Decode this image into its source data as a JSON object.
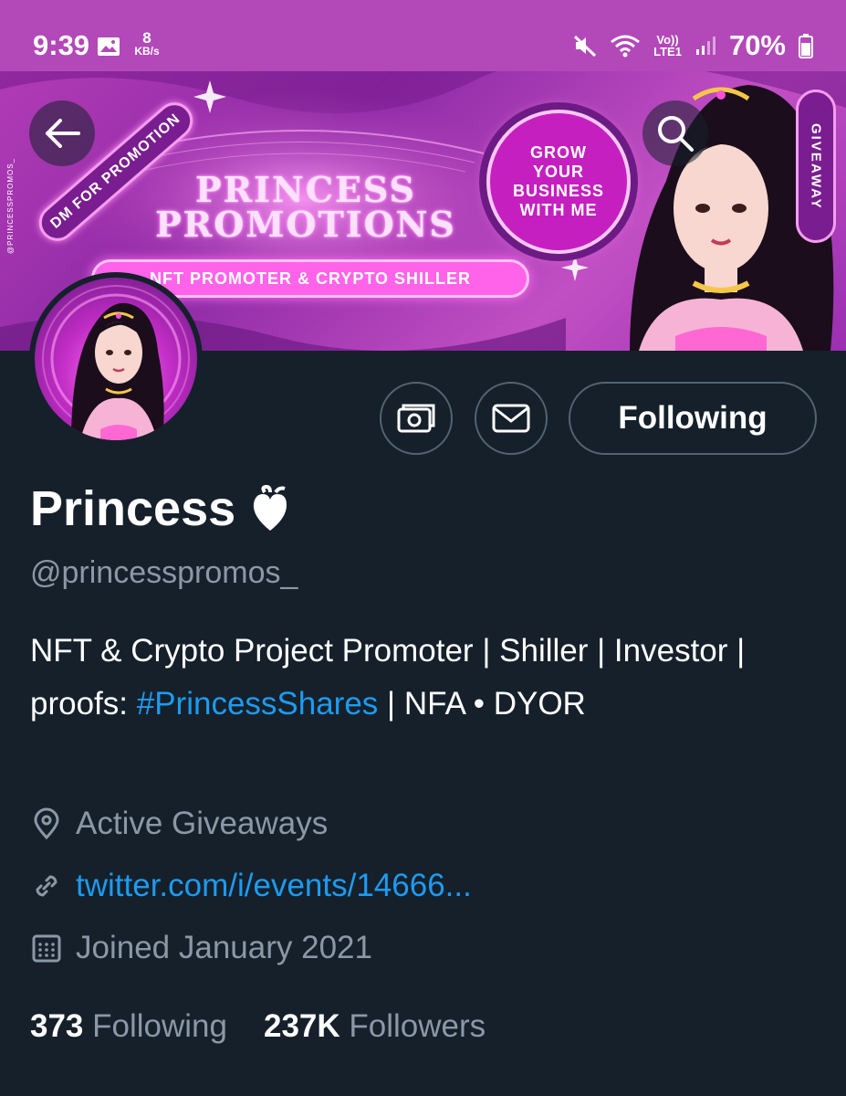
{
  "status_bar": {
    "time": "9:39",
    "net_speed_value": "8",
    "net_speed_unit": "KB/s",
    "volte": "Vo))",
    "lte": "LTE1",
    "battery": "70%"
  },
  "banner": {
    "title_line1": "PRINCESS",
    "title_line2": "PROMOTIONS",
    "tagline": "NFT PROMOTER & CRYPTO SHILLER",
    "dm_badge": "DM FOR PROMOTION",
    "grow_line1": "GROW",
    "grow_line2": "YOUR",
    "grow_line3": "BUSINESS",
    "grow_line4": "WITH ME",
    "giveaway": "GIVEAWAY",
    "vertical_handle": "@PRINCESSPROMOS_",
    "accent_color": "#ff63ea"
  },
  "actions": {
    "follow_label": "Following"
  },
  "profile": {
    "name": "Princess",
    "handle": "@princesspromos_",
    "bio_part1": "NFT & Crypto Project Promoter | Shiller | Investor | proofs: ",
    "bio_hashtag": "#PrincessShares",
    "bio_part2": " | NFA • DYOR",
    "location": "Active Giveaways",
    "link": "twitter.com/i/events/14666...",
    "joined": "Joined January 2021"
  },
  "stats": {
    "following_count": "373",
    "following_label": "Following",
    "followers_count": "237K",
    "followers_label": "Followers"
  },
  "colors": {
    "background": "#15202b",
    "link": "#1d9bf0",
    "secondary_text": "#8b98a5",
    "status_bar": "#b348b8"
  }
}
